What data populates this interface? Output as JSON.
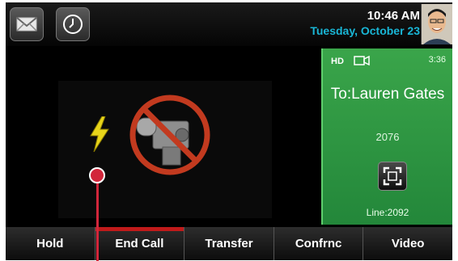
{
  "status_bar": {
    "time": "10:46 AM",
    "date": "Tuesday, October 23",
    "icons": {
      "messages": "envelope-icon",
      "history": "clock-icon"
    }
  },
  "video": {
    "icons": {
      "no_video": "no-video-camera-icon",
      "flash": "lightning-icon"
    }
  },
  "call_panel": {
    "hd_label": "HD",
    "duration": "3:36",
    "to": "To:Lauren Gates",
    "number": "2076",
    "line": "Line:2092",
    "icons": {
      "camera": "camera-icon",
      "fullscreen": "fullscreen-icon"
    }
  },
  "softkeys": [
    "Hold",
    "End Call",
    "Transfer",
    "Confrnc",
    "Video"
  ],
  "colors": {
    "accent_date": "#19b6d6",
    "panel_green": "#2f9a44",
    "end_call_red": "#c01a1a",
    "pointer_red": "#d2263b"
  }
}
